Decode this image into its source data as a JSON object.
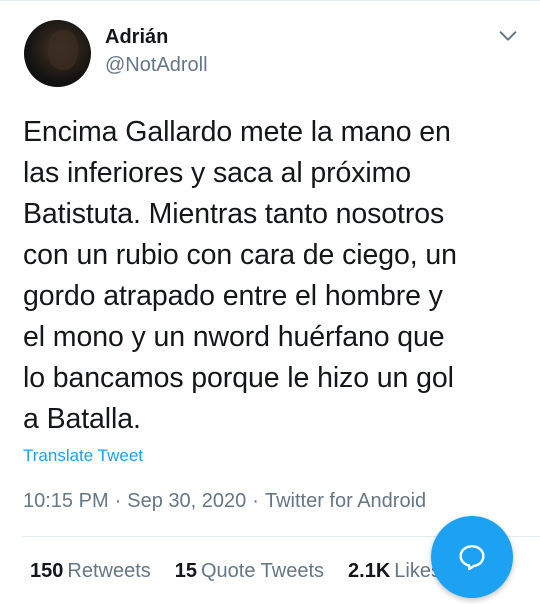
{
  "tweet": {
    "author": {
      "display_name": "Adrián",
      "handle": "@NotAdroll"
    },
    "text": "Encima Gallardo mete la mano en\nlas inferiores y saca al próximo\nBatistuta. Mientras tanto nosotros\ncon un rubio con cara de ciego, un\ngordo atrapado entre el hombre y\nel mono y un nword huérfano que\nlo bancamos porque le hizo un gol\na Batalla.",
    "translate_label": "Translate Tweet",
    "time": "10:15 PM",
    "date": "Sep 30, 2020",
    "source": "Twitter for Android",
    "separator": "·"
  },
  "stats": {
    "retweets": {
      "count": "150",
      "label": "Retweets"
    },
    "quote_tweets": {
      "count": "15",
      "label": "Quote Tweets"
    },
    "likes": {
      "count": "2.1K",
      "label": "Likes"
    }
  },
  "icons": {
    "more": "chevron-down-icon",
    "compose": "reply-bubble-icon"
  },
  "colors": {
    "accent": "#1da1f2",
    "secondary_text": "#657786",
    "primary_text": "#14171a"
  }
}
